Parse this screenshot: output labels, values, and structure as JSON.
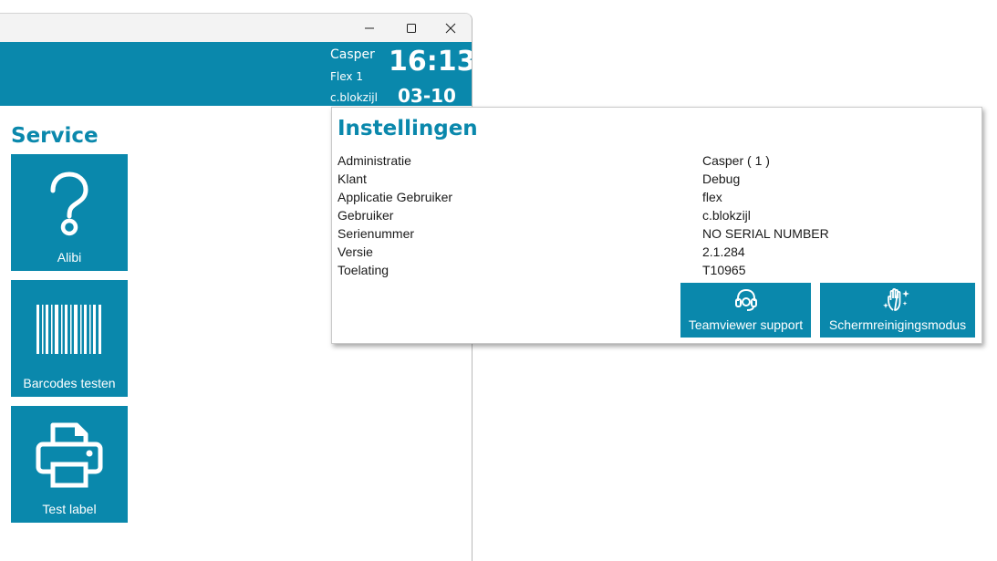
{
  "header": {
    "administration": "Casper",
    "app_user": "Flex 1",
    "user": "c.blokzijl",
    "time": "16:13",
    "date": "03-10"
  },
  "service": {
    "title": "Service",
    "tiles": [
      {
        "label": "Alibi",
        "icon": "question-icon"
      },
      {
        "label": "Barcodes testen",
        "icon": "barcode-icon"
      },
      {
        "label": "Test label",
        "icon": "printer-icon"
      }
    ]
  },
  "settings": {
    "title": "Instellingen",
    "rows": [
      {
        "key": "Administratie",
        "value": "Casper ( 1 )"
      },
      {
        "key": "Klant",
        "value": "Debug"
      },
      {
        "key": "Applicatie Gebruiker",
        "value": "flex"
      },
      {
        "key": "Gebruiker",
        "value": "c.blokzijl"
      },
      {
        "key": "Serienummer",
        "value": "NO SERIAL NUMBER"
      },
      {
        "key": "Versie",
        "value": "2.1.284"
      },
      {
        "key": "Toelating",
        "value": "T10965"
      }
    ],
    "buttons": [
      {
        "label": "Teamviewer support",
        "icon": "headset-icon"
      },
      {
        "label": "Schermreinigingsmodus",
        "icon": "hand-sparkle-icon"
      }
    ]
  },
  "colors": {
    "accent": "#0a88ac"
  }
}
